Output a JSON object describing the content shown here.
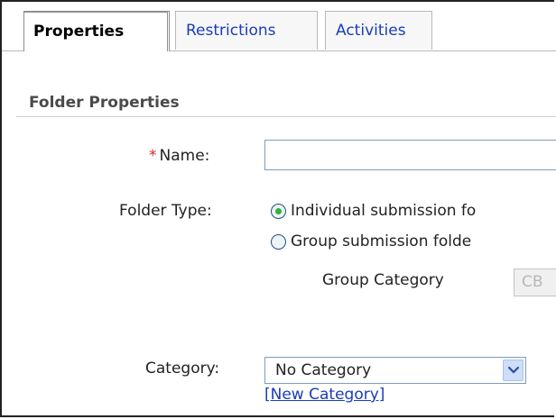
{
  "tabs": {
    "properties": "Properties",
    "restrictions": "Restrictions",
    "activities": "Activities",
    "active": "Properties"
  },
  "section": {
    "title": "Folder Properties"
  },
  "form": {
    "name_required_marker": "*",
    "name_label": "Name:",
    "name_value": "",
    "folder_type_label": "Folder Type:",
    "folder_type_options": [
      {
        "label": "Individual submission fo",
        "selected": true
      },
      {
        "label": "Group submission folde",
        "selected": false
      }
    ],
    "group_category_label": "Group Category",
    "group_category_value": "CB",
    "category_label": "Category:",
    "category_value": "No Category",
    "new_category_link": "[New Category]"
  },
  "colors": {
    "link": "#1a3db8",
    "required": "#d4262a",
    "radio_selected": "#2fb43c"
  },
  "icons": {
    "radio_selected": "radio-selected-icon",
    "radio_unselected": "radio-unselected-icon",
    "dropdown_arrow": "chevron-down-icon"
  }
}
